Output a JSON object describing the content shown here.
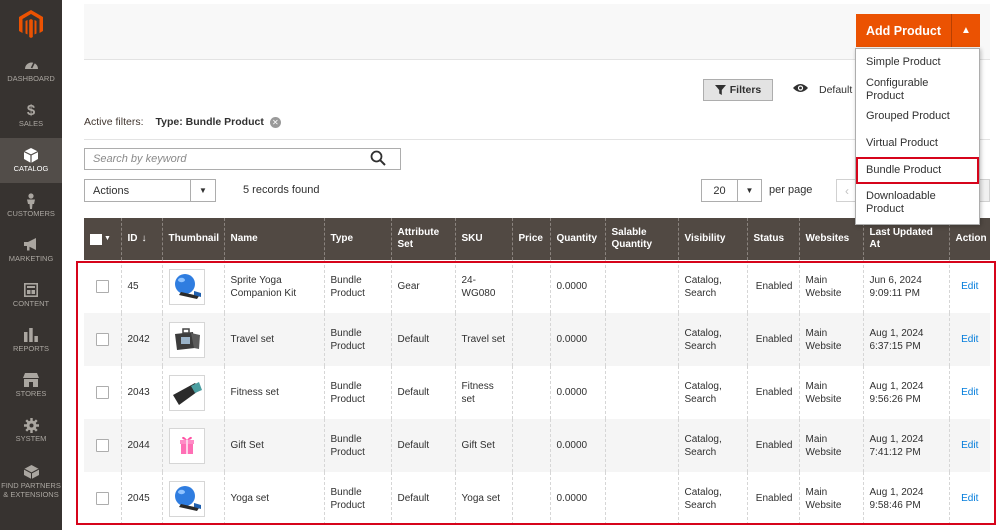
{
  "sidebar": {
    "items": [
      {
        "label": "DASHBOARD",
        "icon": "dashboard-icon"
      },
      {
        "label": "SALES",
        "icon": "dollar-icon"
      },
      {
        "label": "CATALOG",
        "icon": "cube-icon"
      },
      {
        "label": "CUSTOMERS",
        "icon": "person-icon"
      },
      {
        "label": "MARKETING",
        "icon": "megaphone-icon"
      },
      {
        "label": "CONTENT",
        "icon": "content-icon"
      },
      {
        "label": "REPORTS",
        "icon": "bar-chart-icon"
      },
      {
        "label": "STORES",
        "icon": "store-icon"
      },
      {
        "label": "SYSTEM",
        "icon": "gear-icon"
      },
      {
        "label": "FIND PARTNERS & EXTENSIONS",
        "icon": "extensions-icon"
      }
    ]
  },
  "header": {
    "add_product_label": "Add Product",
    "menu": [
      "Simple Product",
      "Configurable Product",
      "Grouped Product",
      "Virtual Product",
      "Bundle Product",
      "Downloadable Product"
    ]
  },
  "toolbar": {
    "filters_label": "Filters",
    "default_view_label": "Default View",
    "active_filters_label": "Active filters:",
    "active_filter_value": "Type: Bundle Product",
    "search_placeholder": "Search by keyword",
    "actions_label": "Actions",
    "records_found": "5 records found",
    "per_page_value": "20",
    "per_page_label": "per page"
  },
  "grid": {
    "columns": [
      "ID",
      "Thumbnail",
      "Name",
      "Type",
      "Attribute Set",
      "SKU",
      "Price",
      "Quantity",
      "Salable Quantity",
      "Visibility",
      "Status",
      "Websites",
      "Last Updated At",
      "Action"
    ],
    "sort_indicator": "↓",
    "rows": [
      {
        "id": "45",
        "thumb": "yoga-ball-thumbnail",
        "name": "Sprite Yoga Companion Kit",
        "type": "Bundle Product",
        "attr_set": "Gear",
        "sku": "24-WG080",
        "price": "",
        "quantity": "0.0000",
        "salable": "",
        "visibility": "Catalog, Search",
        "status": "Enabled",
        "websites": "Main Website",
        "updated": "Jun 6, 2024 9:09:11 PM",
        "action": "Edit"
      },
      {
        "id": "2042",
        "thumb": "travel-bag-thumbnail",
        "name": "Travel set",
        "type": "Bundle Product",
        "attr_set": "Default",
        "sku": "Travel set",
        "price": "",
        "quantity": "0.0000",
        "salable": "",
        "visibility": "Catalog, Search",
        "status": "Enabled",
        "websites": "Main Website",
        "updated": "Aug 1, 2024 6:37:15 PM",
        "action": "Edit"
      },
      {
        "id": "2043",
        "thumb": "yoga-mat-thumbnail",
        "name": "Fitness set",
        "type": "Bundle Product",
        "attr_set": "Default",
        "sku": "Fitness set",
        "price": "",
        "quantity": "0.0000",
        "salable": "",
        "visibility": "Catalog, Search",
        "status": "Enabled",
        "websites": "Main Website",
        "updated": "Aug 1, 2024 9:56:26 PM",
        "action": "Edit"
      },
      {
        "id": "2044",
        "thumb": "gift-box-thumbnail",
        "name": "Gift Set",
        "type": "Bundle Product",
        "attr_set": "Default",
        "sku": "Gift Set",
        "price": "",
        "quantity": "0.0000",
        "salable": "",
        "visibility": "Catalog, Search",
        "status": "Enabled",
        "websites": "Main Website",
        "updated": "Aug 1, 2024 7:41:12 PM",
        "action": "Edit"
      },
      {
        "id": "2045",
        "thumb": "yoga-ball-thumbnail",
        "name": "Yoga set",
        "type": "Bundle Product",
        "attr_set": "Default",
        "sku": "Yoga set",
        "price": "",
        "quantity": "0.0000",
        "salable": "",
        "visibility": "Catalog, Search",
        "status": "Enabled",
        "websites": "Main Website",
        "updated": "Aug 1, 2024 9:58:46 PM",
        "action": "Edit"
      }
    ]
  },
  "colors": {
    "sidebar_bg": "#373330",
    "accent": "#eb5202",
    "grid_header_bg": "#514943",
    "highlight_frame": "#d6041b",
    "link": "#007bdb"
  }
}
